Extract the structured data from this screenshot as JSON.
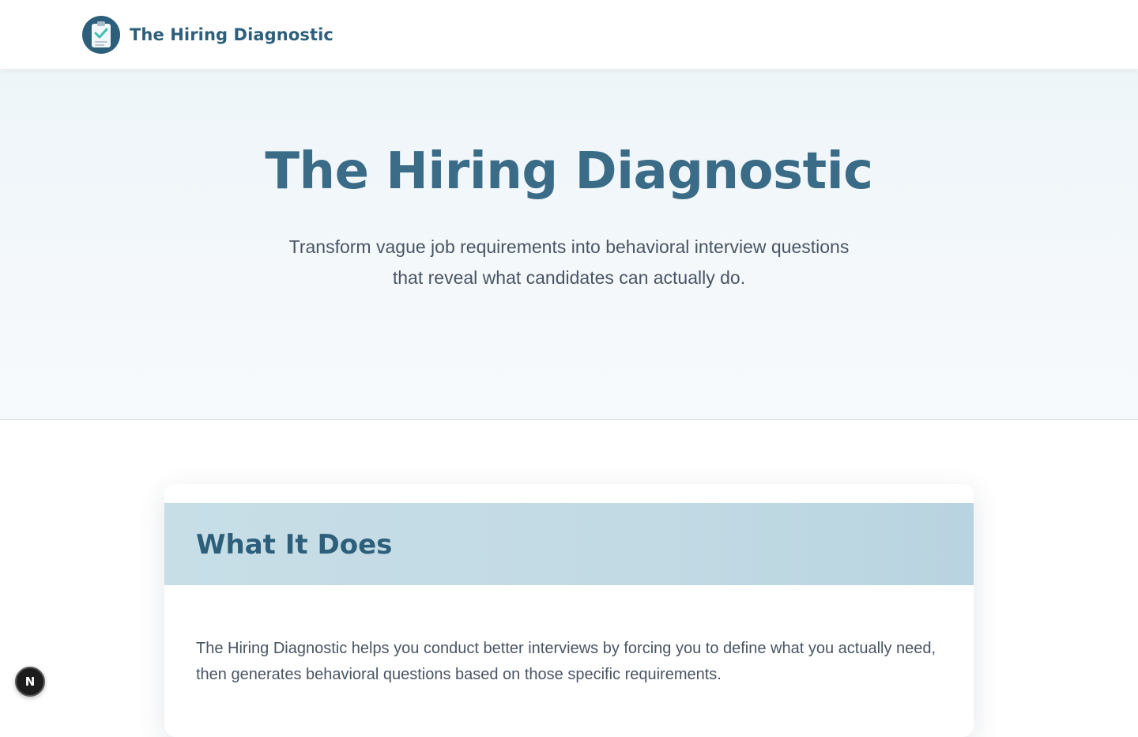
{
  "header": {
    "brand_name": "The Hiring Diagnostic",
    "logo_icon": "clipboard-check-icon"
  },
  "hero": {
    "title": "The Hiring Diagnostic",
    "subtitle_line1": "Transform vague job requirements into behavioral interview questions",
    "subtitle_line2": "that reveal what candidates can actually do."
  },
  "card": {
    "title": "What It Does",
    "body_line1": "The Hiring Diagnostic helps you conduct better interviews by forcing you to define what you actually need,",
    "body_line2": "then generates behavioral questions based on those specific requirements."
  },
  "dev_badge": {
    "label": "N"
  },
  "colors": {
    "brand": "#2d5f7a",
    "hero_title": "#3a6b87",
    "body_text": "#4a5563",
    "card_header_bg": "#c2dae4",
    "accent_check": "#3fbfb0"
  }
}
